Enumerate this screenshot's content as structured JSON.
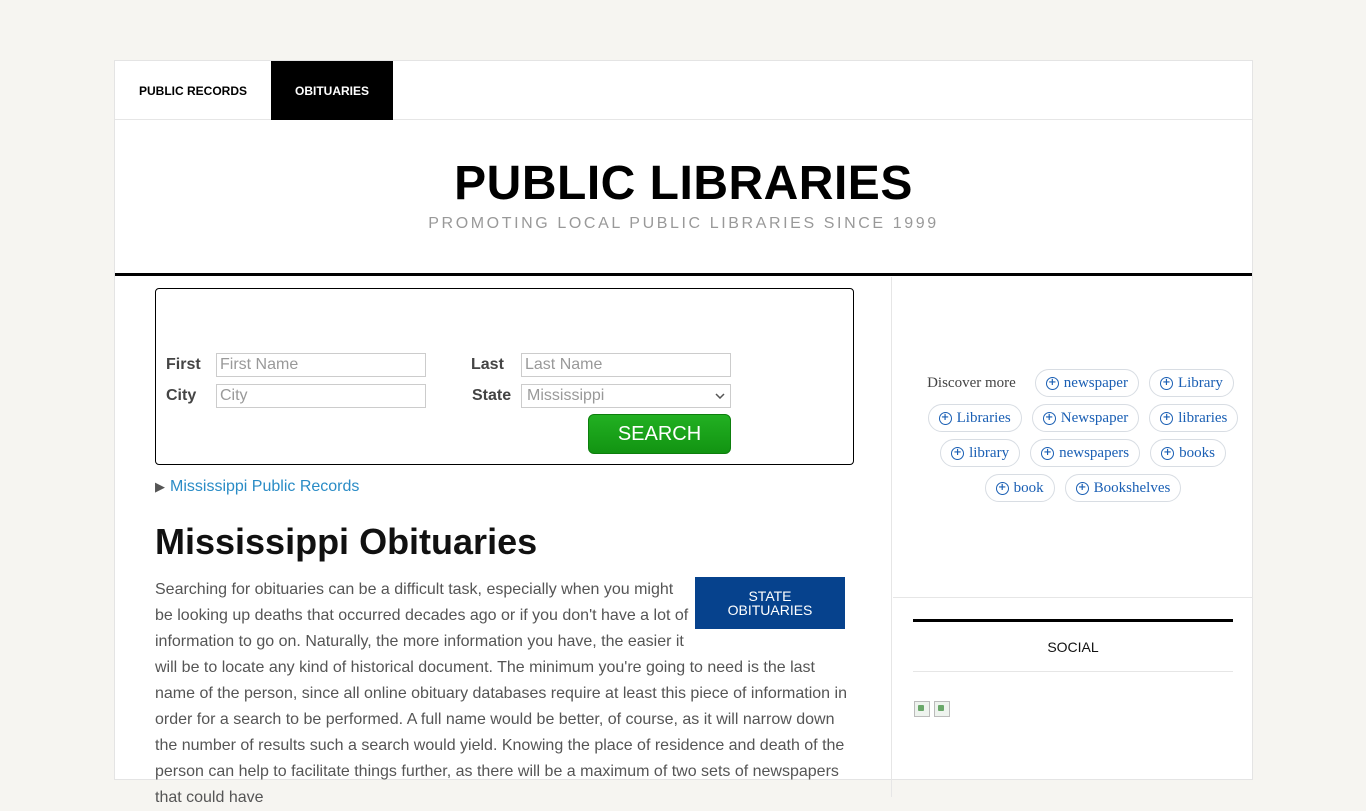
{
  "nav": {
    "items": [
      {
        "label": "PUBLIC RECORDS"
      },
      {
        "label": "OBITUARIES"
      }
    ]
  },
  "masthead": {
    "title": "PUBLIC LIBRARIES",
    "tagline": "PROMOTING LOCAL PUBLIC LIBRARIES SINCE 1999"
  },
  "search": {
    "first_label": "First",
    "first_placeholder": "First Name",
    "last_label": "Last",
    "last_placeholder": "Last Name",
    "city_label": "City",
    "city_placeholder": "City",
    "state_label": "State",
    "state_selected": "Mississippi",
    "button_label": "SEARCH"
  },
  "records_link": "Mississippi Public Records",
  "page_title": "Mississippi Obituaries",
  "state_button": {
    "line1": "STATE",
    "line2": "OBITUARIES"
  },
  "article_text": "Searching for obituaries can be a difficult task, especially when you might be looking up deaths that occurred decades ago or if you don't have a lot of information to go on. Naturally, the more information you have, the easier it will be to locate any kind of historical document. The minimum you're going to need is the last name of the person, since all online obituary databases require at least this piece of information in order for a search to be performed. A full name would be better, of course, as it will narrow down the number of results such a search would yield. Knowing the place of residence and death of the person can help to facilitate things further, as there will be a maximum of two sets of newspapers that could have",
  "discover": {
    "label": "Discover more",
    "chips": [
      "newspaper",
      "Library",
      "Libraries",
      "Newspaper",
      "libraries",
      "library",
      "newspapers",
      "books",
      "book",
      "Bookshelves"
    ]
  },
  "social": {
    "heading": "SOCIAL"
  },
  "colors": {
    "accent_link": "#2a8cc6",
    "search_button": "#129412",
    "state_button": "#06428d",
    "chip_text": "#1a5fb4"
  }
}
